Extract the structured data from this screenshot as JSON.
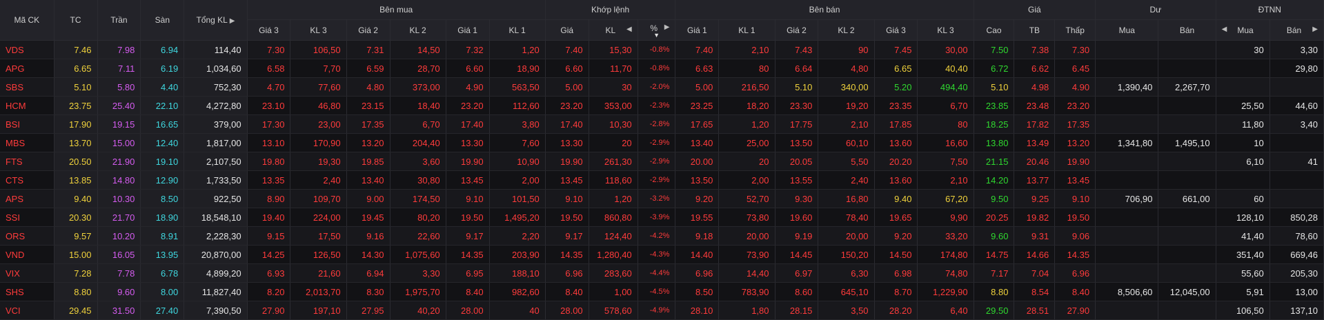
{
  "header": {
    "groups": {
      "symbol": "Mã CK",
      "ref": "TC",
      "ceiling": "Trần",
      "floor": "Sàn",
      "total_vol": "Tổng KL",
      "buy_side": "Bên mua",
      "matched": "Khớp lệnh",
      "sell_side": "Bên bán",
      "price": "Giá",
      "surplus": "Dư",
      "foreign": "ĐTNN"
    },
    "sub": {
      "bid3_price": "Giá 3",
      "bid3_vol": "KL 3",
      "bid2_price": "Giá 2",
      "bid2_vol": "KL 2",
      "bid1_price": "Giá 1",
      "bid1_vol": "KL 1",
      "match_price": "Giá",
      "match_vol": "KL",
      "match_pct": "%",
      "ask1_price": "Giá 1",
      "ask1_vol": "KL 1",
      "ask2_price": "Giá 2",
      "ask2_vol": "KL 2",
      "ask3_price": "Giá 3",
      "ask3_vol": "KL 3",
      "high": "Cao",
      "avg": "TB",
      "low": "Thấp",
      "surplus_buy": "Mua",
      "surplus_sell": "Bán",
      "foreign_buy": "Mua",
      "foreign_sell": "Bán"
    }
  },
  "colors": {
    "red": "#ff3b3b",
    "green": "#2fd82f",
    "yellow": "#f0d23c",
    "purple": "#d55cf0",
    "cyan": "#3fd7df",
    "white": "#e6e6e6"
  },
  "rows": [
    {
      "sym": "VDS",
      "ref": "7.46",
      "ceil": "7.98",
      "floor": "6.94",
      "total": "114,40",
      "b3p": "7.30",
      "b3v": "106,50",
      "b2p": "7.31",
      "b2v": "14,50",
      "b1p": "7.32",
      "b1v": "1,20",
      "mp": "7.40",
      "mv": "15,30",
      "pct": "-0.8%",
      "a1p": "7.40",
      "a1v": "2,10",
      "a2p": "7.43",
      "a2v": "90",
      "a3p": "7.45",
      "a3v": "30,00",
      "high": "7.50",
      "avg": "7.38",
      "low": "7.30",
      "sb": "",
      "ss": "",
      "fb": "30",
      "fs": "3,30",
      "a3c": "red",
      "highc": "green"
    },
    {
      "sym": "APG",
      "ref": "6.65",
      "ceil": "7.11",
      "floor": "6.19",
      "total": "1,034,60",
      "b3p": "6.58",
      "b3v": "7,70",
      "b2p": "6.59",
      "b2v": "28,70",
      "b1p": "6.60",
      "b1v": "18,90",
      "mp": "6.60",
      "mv": "11,70",
      "pct": "-0.8%",
      "a1p": "6.63",
      "a1v": "80",
      "a2p": "6.64",
      "a2v": "4,80",
      "a3p": "6.65",
      "a3v": "40,40",
      "high": "6.72",
      "avg": "6.62",
      "low": "6.45",
      "sb": "",
      "ss": "",
      "fb": "",
      "fs": "29,80",
      "a3c": "yellow",
      "highc": "green"
    },
    {
      "sym": "SBS",
      "ref": "5.10",
      "ceil": "5.80",
      "floor": "4.40",
      "total": "752,30",
      "b3p": "4.70",
      "b3v": "77,60",
      "b2p": "4.80",
      "b2v": "373,00",
      "b1p": "4.90",
      "b1v": "563,50",
      "mp": "5.00",
      "mv": "30",
      "pct": "-2.0%",
      "a1p": "5.00",
      "a1v": "216,50",
      "a2p": "5.10",
      "a2v": "340,00",
      "a3p": "5.20",
      "a3v": "494,40",
      "high": "5.10",
      "avg": "4.98",
      "low": "4.90",
      "sb": "1,390,40",
      "ss": "2,267,70",
      "fb": "",
      "fs": "",
      "a2c": "yellow",
      "a3c": "green",
      "highc": "yellow"
    },
    {
      "sym": "HCM",
      "ref": "23.75",
      "ceil": "25.40",
      "floor": "22.10",
      "total": "4,272,80",
      "b3p": "23.10",
      "b3v": "46,80",
      "b2p": "23.15",
      "b2v": "18,40",
      "b1p": "23.20",
      "b1v": "112,60",
      "mp": "23.20",
      "mv": "353,00",
      "pct": "-2.3%",
      "a1p": "23.25",
      "a1v": "18,20",
      "a2p": "23.30",
      "a2v": "19,20",
      "a3p": "23.35",
      "a3v": "6,70",
      "high": "23.85",
      "avg": "23.48",
      "low": "23.20",
      "sb": "",
      "ss": "",
      "fb": "25,50",
      "fs": "44,60",
      "a3c": "red",
      "highc": "green"
    },
    {
      "sym": "BSI",
      "ref": "17.90",
      "ceil": "19.15",
      "floor": "16.65",
      "total": "379,00",
      "b3p": "17.30",
      "b3v": "23,00",
      "b2p": "17.35",
      "b2v": "6,70",
      "b1p": "17.40",
      "b1v": "3,80",
      "mp": "17.40",
      "mv": "10,30",
      "pct": "-2.8%",
      "a1p": "17.65",
      "a1v": "1,20",
      "a2p": "17.75",
      "a2v": "2,10",
      "a3p": "17.85",
      "a3v": "80",
      "high": "18.25",
      "avg": "17.82",
      "low": "17.35",
      "sb": "",
      "ss": "",
      "fb": "11,80",
      "fs": "3,40",
      "a3c": "red",
      "highc": "green"
    },
    {
      "sym": "MBS",
      "ref": "13.70",
      "ceil": "15.00",
      "floor": "12.40",
      "total": "1,817,00",
      "b3p": "13.10",
      "b3v": "170,90",
      "b2p": "13.20",
      "b2v": "204,40",
      "b1p": "13.30",
      "b1v": "7,60",
      "mp": "13.30",
      "mv": "20",
      "pct": "-2.9%",
      "a1p": "13.40",
      "a1v": "25,00",
      "a2p": "13.50",
      "a2v": "60,10",
      "a3p": "13.60",
      "a3v": "16,60",
      "high": "13.80",
      "avg": "13.49",
      "low": "13.20",
      "sb": "1,341,80",
      "ss": "1,495,10",
      "fb": "10",
      "fs": "",
      "a3c": "red",
      "highc": "green"
    },
    {
      "sym": "FTS",
      "ref": "20.50",
      "ceil": "21.90",
      "floor": "19.10",
      "total": "2,107,50",
      "b3p": "19.80",
      "b3v": "19,30",
      "b2p": "19.85",
      "b2v": "3,60",
      "b1p": "19.90",
      "b1v": "10,90",
      "mp": "19.90",
      "mv": "261,30",
      "pct": "-2.9%",
      "a1p": "20.00",
      "a1v": "20",
      "a2p": "20.05",
      "a2v": "5,50",
      "a3p": "20.20",
      "a3v": "7,50",
      "high": "21.15",
      "avg": "20.46",
      "low": "19.90",
      "sb": "",
      "ss": "",
      "fb": "6,10",
      "fs": "41",
      "a3c": "red",
      "highc": "green"
    },
    {
      "sym": "CTS",
      "ref": "13.85",
      "ceil": "14.80",
      "floor": "12.90",
      "total": "1,733,50",
      "b3p": "13.35",
      "b3v": "2,40",
      "b2p": "13.40",
      "b2v": "30,80",
      "b1p": "13.45",
      "b1v": "2,00",
      "mp": "13.45",
      "mv": "118,60",
      "pct": "-2.9%",
      "a1p": "13.50",
      "a1v": "2,00",
      "a2p": "13.55",
      "a2v": "2,40",
      "a3p": "13.60",
      "a3v": "2,10",
      "high": "14.20",
      "avg": "13.77",
      "low": "13.45",
      "sb": "",
      "ss": "",
      "fb": "",
      "fs": "",
      "a3c": "red",
      "highc": "green"
    },
    {
      "sym": "APS",
      "ref": "9.40",
      "ceil": "10.30",
      "floor": "8.50",
      "total": "922,50",
      "b3p": "8.90",
      "b3v": "109,70",
      "b2p": "9.00",
      "b2v": "174,50",
      "b1p": "9.10",
      "b1v": "101,50",
      "mp": "9.10",
      "mv": "1,20",
      "pct": "-3.2%",
      "a1p": "9.20",
      "a1v": "52,70",
      "a2p": "9.30",
      "a2v": "16,80",
      "a3p": "9.40",
      "a3v": "67,20",
      "high": "9.50",
      "avg": "9.25",
      "low": "9.10",
      "sb": "706,90",
      "ss": "661,00",
      "fb": "60",
      "fs": "",
      "a3c": "yellow",
      "highc": "green"
    },
    {
      "sym": "SSI",
      "ref": "20.30",
      "ceil": "21.70",
      "floor": "18.90",
      "total": "18,548,10",
      "b3p": "19.40",
      "b3v": "224,00",
      "b2p": "19.45",
      "b2v": "80,20",
      "b1p": "19.50",
      "b1v": "1,495,20",
      "mp": "19.50",
      "mv": "860,80",
      "pct": "-3.9%",
      "a1p": "19.55",
      "a1v": "73,80",
      "a2p": "19.60",
      "a2v": "78,40",
      "a3p": "19.65",
      "a3v": "9,90",
      "high": "20.25",
      "avg": "19.82",
      "low": "19.50",
      "sb": "",
      "ss": "",
      "fb": "128,10",
      "fs": "850,28",
      "a3c": "red",
      "highc": "red"
    },
    {
      "sym": "ORS",
      "ref": "9.57",
      "ceil": "10.20",
      "floor": "8.91",
      "total": "2,228,30",
      "b3p": "9.15",
      "b3v": "17,50",
      "b2p": "9.16",
      "b2v": "22,60",
      "b1p": "9.17",
      "b1v": "2,20",
      "mp": "9.17",
      "mv": "124,40",
      "pct": "-4.2%",
      "a1p": "9.18",
      "a1v": "20,00",
      "a2p": "9.19",
      "a2v": "20,00",
      "a3p": "9.20",
      "a3v": "33,20",
      "high": "9.60",
      "avg": "9.31",
      "low": "9.06",
      "sb": "",
      "ss": "",
      "fb": "41,40",
      "fs": "78,60",
      "a3c": "red",
      "highc": "green"
    },
    {
      "sym": "VND",
      "ref": "15.00",
      "ceil": "16.05",
      "floor": "13.95",
      "total": "20,870,00",
      "b3p": "14.25",
      "b3v": "126,50",
      "b2p": "14.30",
      "b2v": "1,075,60",
      "b1p": "14.35",
      "b1v": "203,90",
      "mp": "14.35",
      "mv": "1,280,40",
      "pct": "-4.3%",
      "a1p": "14.40",
      "a1v": "73,90",
      "a2p": "14.45",
      "a2v": "150,20",
      "a3p": "14.50",
      "a3v": "174,80",
      "high": "14.75",
      "avg": "14.66",
      "low": "14.35",
      "sb": "",
      "ss": "",
      "fb": "351,40",
      "fs": "669,46",
      "a3c": "red",
      "highc": "red"
    },
    {
      "sym": "VIX",
      "ref": "7.28",
      "ceil": "7.78",
      "floor": "6.78",
      "total": "4,899,20",
      "b3p": "6.93",
      "b3v": "21,60",
      "b2p": "6.94",
      "b2v": "3,30",
      "b1p": "6.95",
      "b1v": "188,10",
      "mp": "6.96",
      "mv": "283,60",
      "pct": "-4.4%",
      "a1p": "6.96",
      "a1v": "14,40",
      "a2p": "6.97",
      "a2v": "6,30",
      "a3p": "6.98",
      "a3v": "74,80",
      "high": "7.17",
      "avg": "7.04",
      "low": "6.96",
      "sb": "",
      "ss": "",
      "fb": "55,60",
      "fs": "205,30",
      "a3c": "red",
      "highc": "red"
    },
    {
      "sym": "SHS",
      "ref": "8.80",
      "ceil": "9.60",
      "floor": "8.00",
      "total": "11,827,40",
      "b3p": "8.20",
      "b3v": "2,013,70",
      "b2p": "8.30",
      "b2v": "1,975,70",
      "b1p": "8.40",
      "b1v": "982,60",
      "mp": "8.40",
      "mv": "1,00",
      "pct": "-4.5%",
      "a1p": "8.50",
      "a1v": "783,90",
      "a2p": "8.60",
      "a2v": "645,10",
      "a3p": "8.70",
      "a3v": "1,229,90",
      "high": "8.80",
      "avg": "8.54",
      "low": "8.40",
      "sb": "8,506,60",
      "ss": "12,045,00",
      "fb": "5,91",
      "fs": "13,00",
      "a3c": "red",
      "highc": "yellow"
    },
    {
      "sym": "VCI",
      "ref": "29.45",
      "ceil": "31.50",
      "floor": "27.40",
      "total": "7,390,50",
      "b3p": "27.90",
      "b3v": "197,10",
      "b2p": "27.95",
      "b2v": "40,20",
      "b1p": "28.00",
      "b1v": "40",
      "mp": "28.00",
      "mv": "578,60",
      "pct": "-4.9%",
      "a1p": "28.10",
      "a1v": "1,80",
      "a2p": "28.15",
      "a2v": "3,50",
      "a3p": "28.20",
      "a3v": "6,40",
      "high": "29.50",
      "avg": "28.51",
      "low": "27.90",
      "sb": "",
      "ss": "",
      "fb": "106,50",
      "fs": "137,10",
      "a3c": "red",
      "highc": "green"
    }
  ]
}
